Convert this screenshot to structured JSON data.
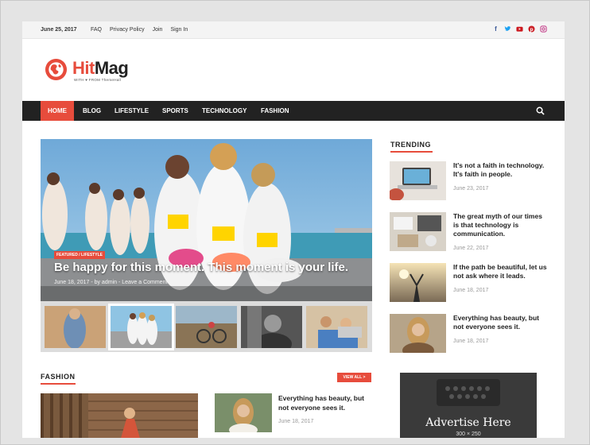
{
  "topbar": {
    "date": "June 25, 2017",
    "links": [
      "FAQ",
      "Privacy Policy",
      "Join",
      "Sign In"
    ],
    "social_icons": [
      "facebook-icon",
      "twitter-icon",
      "youtube-icon",
      "pinterest-icon",
      "instagram-icon"
    ]
  },
  "logo": {
    "part1": "Hit",
    "part2": "Mag",
    "tagline": "WITH ♥ FROM ThemeHall"
  },
  "nav": {
    "items": [
      "HOME",
      "BLOG",
      "LIFESTYLE",
      "SPORTS",
      "TECHNOLOGY",
      "FASHION"
    ]
  },
  "hero": {
    "badge": "FEATURED / LIFESTYLE",
    "title": "Be happy for this moment. This moment is your life.",
    "meta": "June 18, 2017 - by admin - Leave a Comment"
  },
  "trending": {
    "title": "TRENDING",
    "items": [
      {
        "title": "It's not a faith in technology. It's faith in people.",
        "date": "June 23, 2017"
      },
      {
        "title": "The great myth of our times is that technology is communication.",
        "date": "June 22, 2017"
      },
      {
        "title": "If the path be beautiful, let us not ask where it leads.",
        "date": "June 18, 2017"
      },
      {
        "title": "Everything has beauty, but not everyone sees it.",
        "date": "June 18, 2017"
      }
    ]
  },
  "fashion": {
    "title": "FASHION",
    "view_all": "VIEW ALL >",
    "item": {
      "title": "Everything has beauty, but not everyone sees it.",
      "date": "June 18, 2017"
    }
  },
  "advert": {
    "text": "Advertise Here",
    "size": "300 × 250"
  },
  "colors": {
    "accent": "#e74c3c",
    "nav_bg": "#222222"
  }
}
